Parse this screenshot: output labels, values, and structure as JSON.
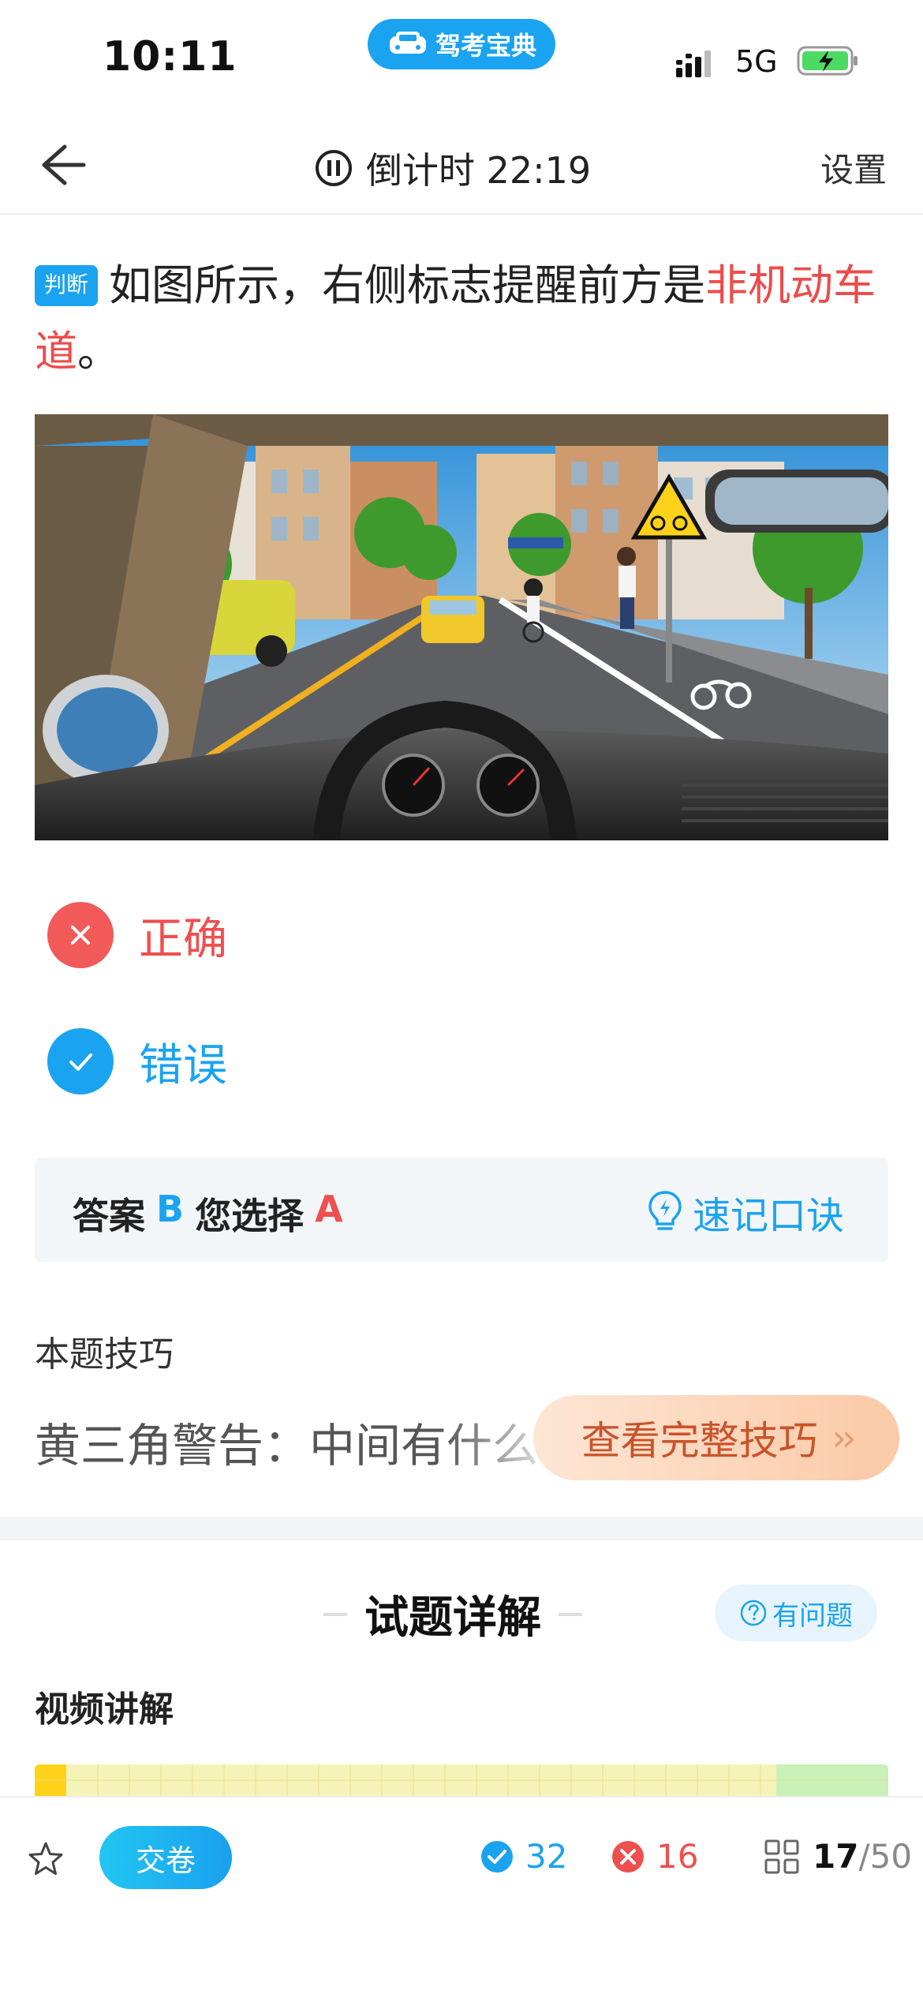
{
  "status_bar": {
    "time": "10:11",
    "app_name": "驾考宝典",
    "network": "5G",
    "icons": [
      "signal-icon",
      "battery-charging-icon"
    ]
  },
  "nav": {
    "timer_label": "倒计时 22:19",
    "settings_label": "设置",
    "icons": [
      "back-arrow-icon",
      "pause-icon"
    ]
  },
  "question": {
    "badge": "判断",
    "text_before": "如图所示，右侧标志提醒前方是",
    "text_highlight": "非机动车道",
    "text_after": "。"
  },
  "options": [
    {
      "label": "正确",
      "state": "wrong",
      "icon": "close-icon"
    },
    {
      "label": "错误",
      "state": "correct",
      "icon": "check-icon"
    }
  ],
  "answer": {
    "answer_label": "答案",
    "answer_value": "B",
    "chosen_label": "您选择",
    "chosen_value": "A",
    "mnemonic_label": "速记口诀",
    "mnemonic_icon": "lightbulb-icon"
  },
  "tips": {
    "title": "本题技巧",
    "text": "黄三角警告：中间有什么",
    "button_label": "查看完整技巧",
    "button_chevron": "››"
  },
  "detail": {
    "title": "试题详解",
    "question_button": "有问题",
    "video_title": "视频讲解"
  },
  "bottom": {
    "submit_label": "交卷",
    "correct_count": "32",
    "wrong_count": "16",
    "current": "17",
    "total": "/50",
    "icons": [
      "star-icon",
      "check-circle-icon",
      "close-circle-icon",
      "grid-icon"
    ]
  },
  "colors": {
    "accent": "#1aa3f0",
    "error": "#ef4f4f",
    "tips_button": "#fbc9a6"
  }
}
